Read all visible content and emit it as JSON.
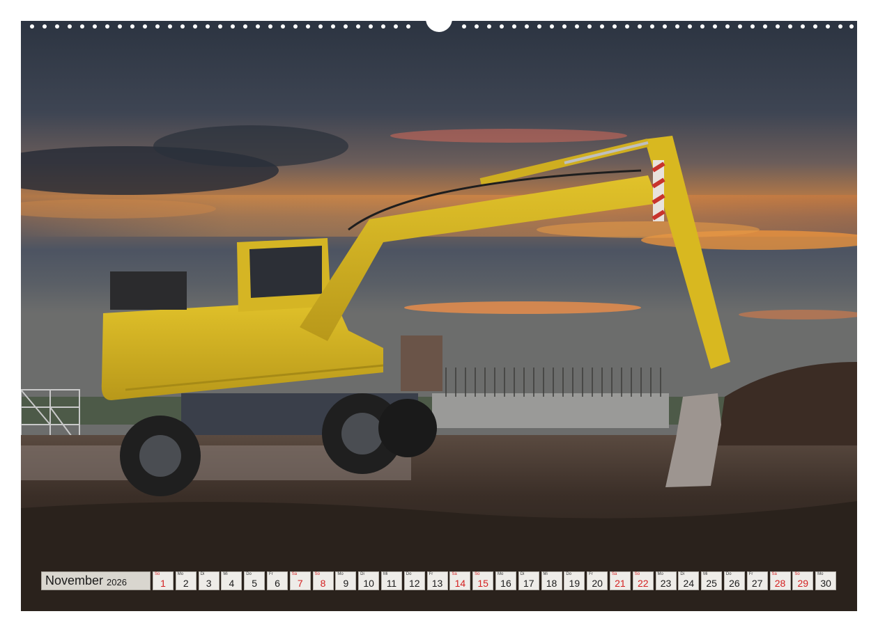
{
  "calendar": {
    "month": "November",
    "year": "2026",
    "days": [
      {
        "wd": "So",
        "num": "1",
        "weekend": true
      },
      {
        "wd": "Mo",
        "num": "2",
        "weekend": false
      },
      {
        "wd": "Di",
        "num": "3",
        "weekend": false
      },
      {
        "wd": "Mi",
        "num": "4",
        "weekend": false
      },
      {
        "wd": "Do",
        "num": "5",
        "weekend": false
      },
      {
        "wd": "Fr",
        "num": "6",
        "weekend": false
      },
      {
        "wd": "Sa",
        "num": "7",
        "weekend": true
      },
      {
        "wd": "So",
        "num": "8",
        "weekend": true
      },
      {
        "wd": "Mo",
        "num": "9",
        "weekend": false
      },
      {
        "wd": "Di",
        "num": "10",
        "weekend": false
      },
      {
        "wd": "Mi",
        "num": "11",
        "weekend": false
      },
      {
        "wd": "Do",
        "num": "12",
        "weekend": false
      },
      {
        "wd": "Fr",
        "num": "13",
        "weekend": false
      },
      {
        "wd": "Sa",
        "num": "14",
        "weekend": true
      },
      {
        "wd": "So",
        "num": "15",
        "weekend": true
      },
      {
        "wd": "Mo",
        "num": "16",
        "weekend": false
      },
      {
        "wd": "Di",
        "num": "17",
        "weekend": false
      },
      {
        "wd": "Mi",
        "num": "18",
        "weekend": false
      },
      {
        "wd": "Do",
        "num": "19",
        "weekend": false
      },
      {
        "wd": "Fr",
        "num": "20",
        "weekend": false
      },
      {
        "wd": "Sa",
        "num": "21",
        "weekend": true
      },
      {
        "wd": "So",
        "num": "22",
        "weekend": true
      },
      {
        "wd": "Mo",
        "num": "23",
        "weekend": false
      },
      {
        "wd": "Di",
        "num": "24",
        "weekend": false
      },
      {
        "wd": "Mi",
        "num": "25",
        "weekend": false
      },
      {
        "wd": "Do",
        "num": "26",
        "weekend": false
      },
      {
        "wd": "Fr",
        "num": "27",
        "weekend": false
      },
      {
        "wd": "Sa",
        "num": "28",
        "weekend": true
      },
      {
        "wd": "So",
        "num": "29",
        "weekend": true
      },
      {
        "wd": "Mo",
        "num": "30",
        "weekend": false
      }
    ]
  },
  "colors": {
    "weekend": "#d42020",
    "machine_yellow": "#d9b81f",
    "sky_glow": "#e3843a"
  }
}
